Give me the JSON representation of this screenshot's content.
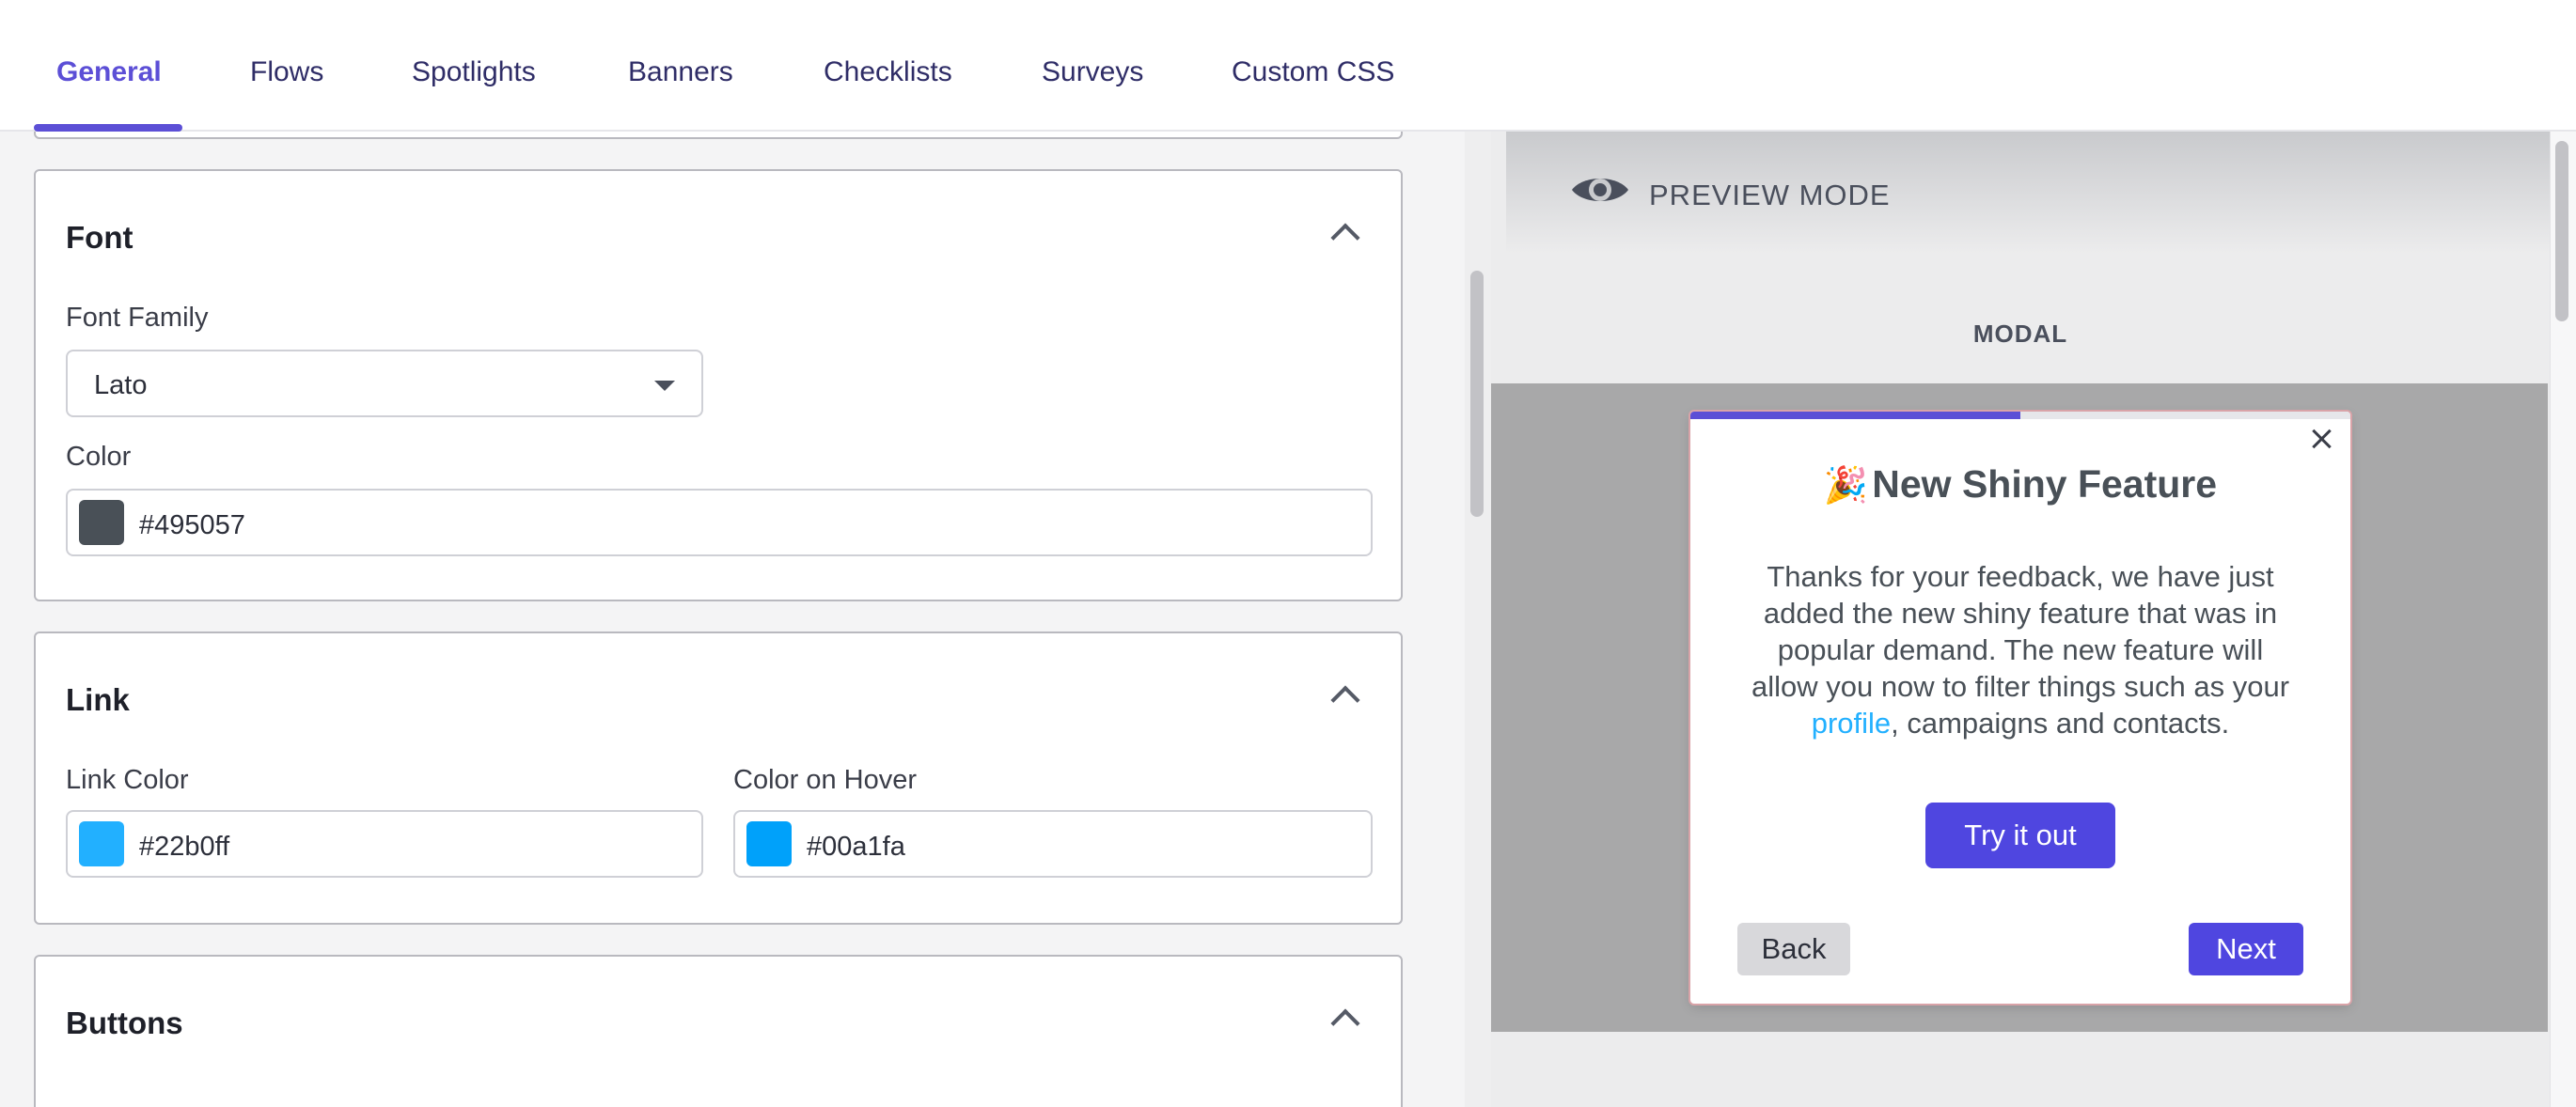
{
  "tabs": [
    {
      "label": "General",
      "active": true
    },
    {
      "label": "Flows"
    },
    {
      "label": "Spotlights"
    },
    {
      "label": "Banners"
    },
    {
      "label": "Checklists"
    },
    {
      "label": "Surveys"
    },
    {
      "label": "Custom CSS"
    }
  ],
  "font_section": {
    "title": "Font",
    "family_label": "Font Family",
    "family_value": "Lato",
    "color_label": "Color",
    "color_value": "#495057",
    "swatch": "#495057"
  },
  "link_section": {
    "title": "Link",
    "link_color_label": "Link Color",
    "link_color_value": "#22b0ff",
    "link_swatch": "#22b0ff",
    "hover_label": "Color on Hover",
    "hover_value": "#00a1fa",
    "hover_swatch": "#00a1fa"
  },
  "buttons_section": {
    "title": "Buttons"
  },
  "preview": {
    "label": "PREVIEW MODE",
    "mode": "MODAL",
    "progress": 0.5,
    "modal": {
      "emoji": "🎉",
      "title": "New Shiny Feature",
      "body_before": "Thanks for your feedback, we have just added the new shiny feature that was in popular demand. The new feature will allow you now to filter things such as your ",
      "body_link": "profile",
      "body_after": ", campaigns and contacts.",
      "cta_label": "Try it out",
      "back_label": "Back",
      "next_label": "Next"
    }
  },
  "colors": {
    "accent": "#5c4fd6",
    "primary_button": "#4f46e0",
    "text": "#495057",
    "link": "#22b0ff"
  }
}
